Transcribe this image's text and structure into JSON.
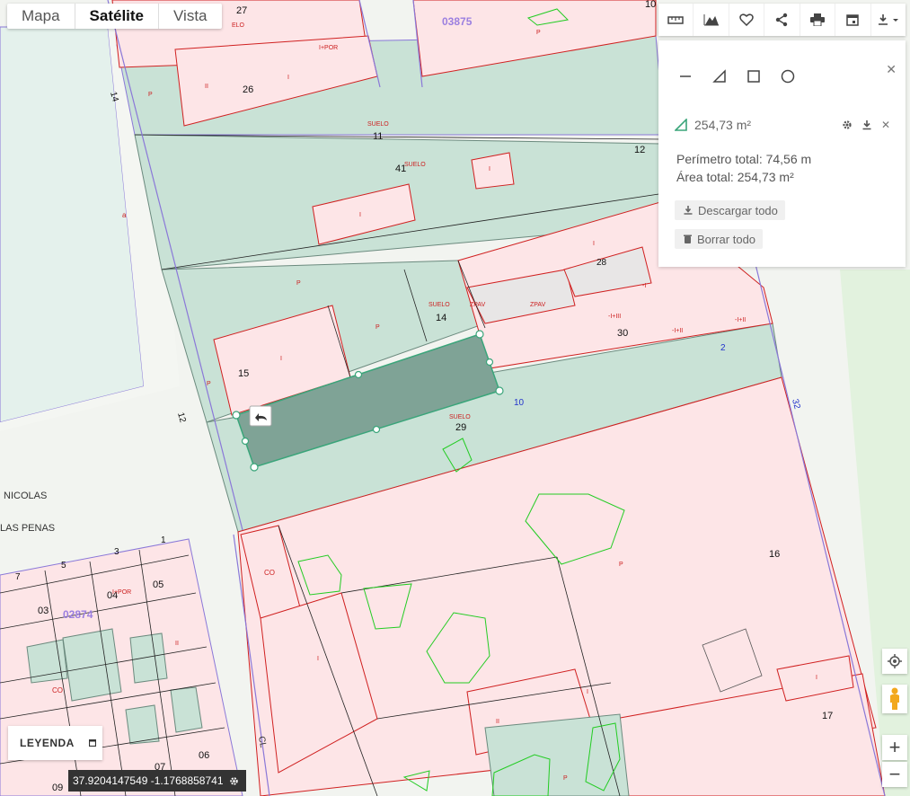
{
  "map_tabs": [
    {
      "label": "Mapa",
      "active": false
    },
    {
      "label": "Satélite",
      "active": true
    },
    {
      "label": "Vista",
      "active": false
    }
  ],
  "toolbar_icons": [
    "ruler-icon",
    "elevation-icon",
    "heart-icon",
    "share-icon",
    "print-icon",
    "calendar-icon",
    "download-icon"
  ],
  "panel": {
    "shape_tools": [
      "line-tool",
      "polygon-tool",
      "rectangle-tool",
      "circle-tool"
    ],
    "measurement_label": "254,73 m²",
    "perimeter_text": "Perímetro total: 74,56 m",
    "area_text": "Área total: 254,73 m²",
    "download_all": "Descargar todo",
    "delete_all": "Borrar todo"
  },
  "legend_label": "LEYENDA",
  "coordinates": "37.92041475​49 -1.1768858741",
  "colors": {
    "parcel_fill": "#fde5e7",
    "road_fill": "#c9e2d6",
    "drawn_polygon": "#7fa396",
    "parcel_line": "#d02020",
    "boundary_line": "#8a78d8",
    "green_outline": "#22cc22"
  },
  "map_labels": {
    "block_03875": "03875",
    "block_02874": "02874",
    "street_nicolas": "NICOLAS",
    "street_las_penas": "LAS PENAS",
    "street_cl": "CL",
    "num_27": "27",
    "num_26": "26",
    "num_11": "11",
    "num_41": "41",
    "num_12_top": "12",
    "num_10_top": "10",
    "num_14": "14",
    "num_15": "15",
    "num_29": "29",
    "num_30": "30",
    "num_28": "28",
    "num_16": "16",
    "num_17": "17",
    "num_12_left": "12",
    "num_14_side": "14",
    "num_2_blue": "2",
    "num_10_blue": "10",
    "num_32": "32",
    "num_7": "7",
    "num_5": "5",
    "num_3": "3",
    "num_1": "1",
    "num_04": "04",
    "num_05": "05",
    "num_03": "03",
    "num_06": "06",
    "num_07": "07",
    "num_09": "09",
    "suelo": "SUELO",
    "hpor": "I+POR",
    "zpav": "ZPAV",
    "iiii": "-I+III",
    "iii": "-I+II",
    "p": "P",
    "i": "I",
    "ii": "II",
    "co": "CO",
    "a": "a",
    "elo": "ELO",
    "minus_i": "-I",
    "ipor_small": "I+POR"
  }
}
